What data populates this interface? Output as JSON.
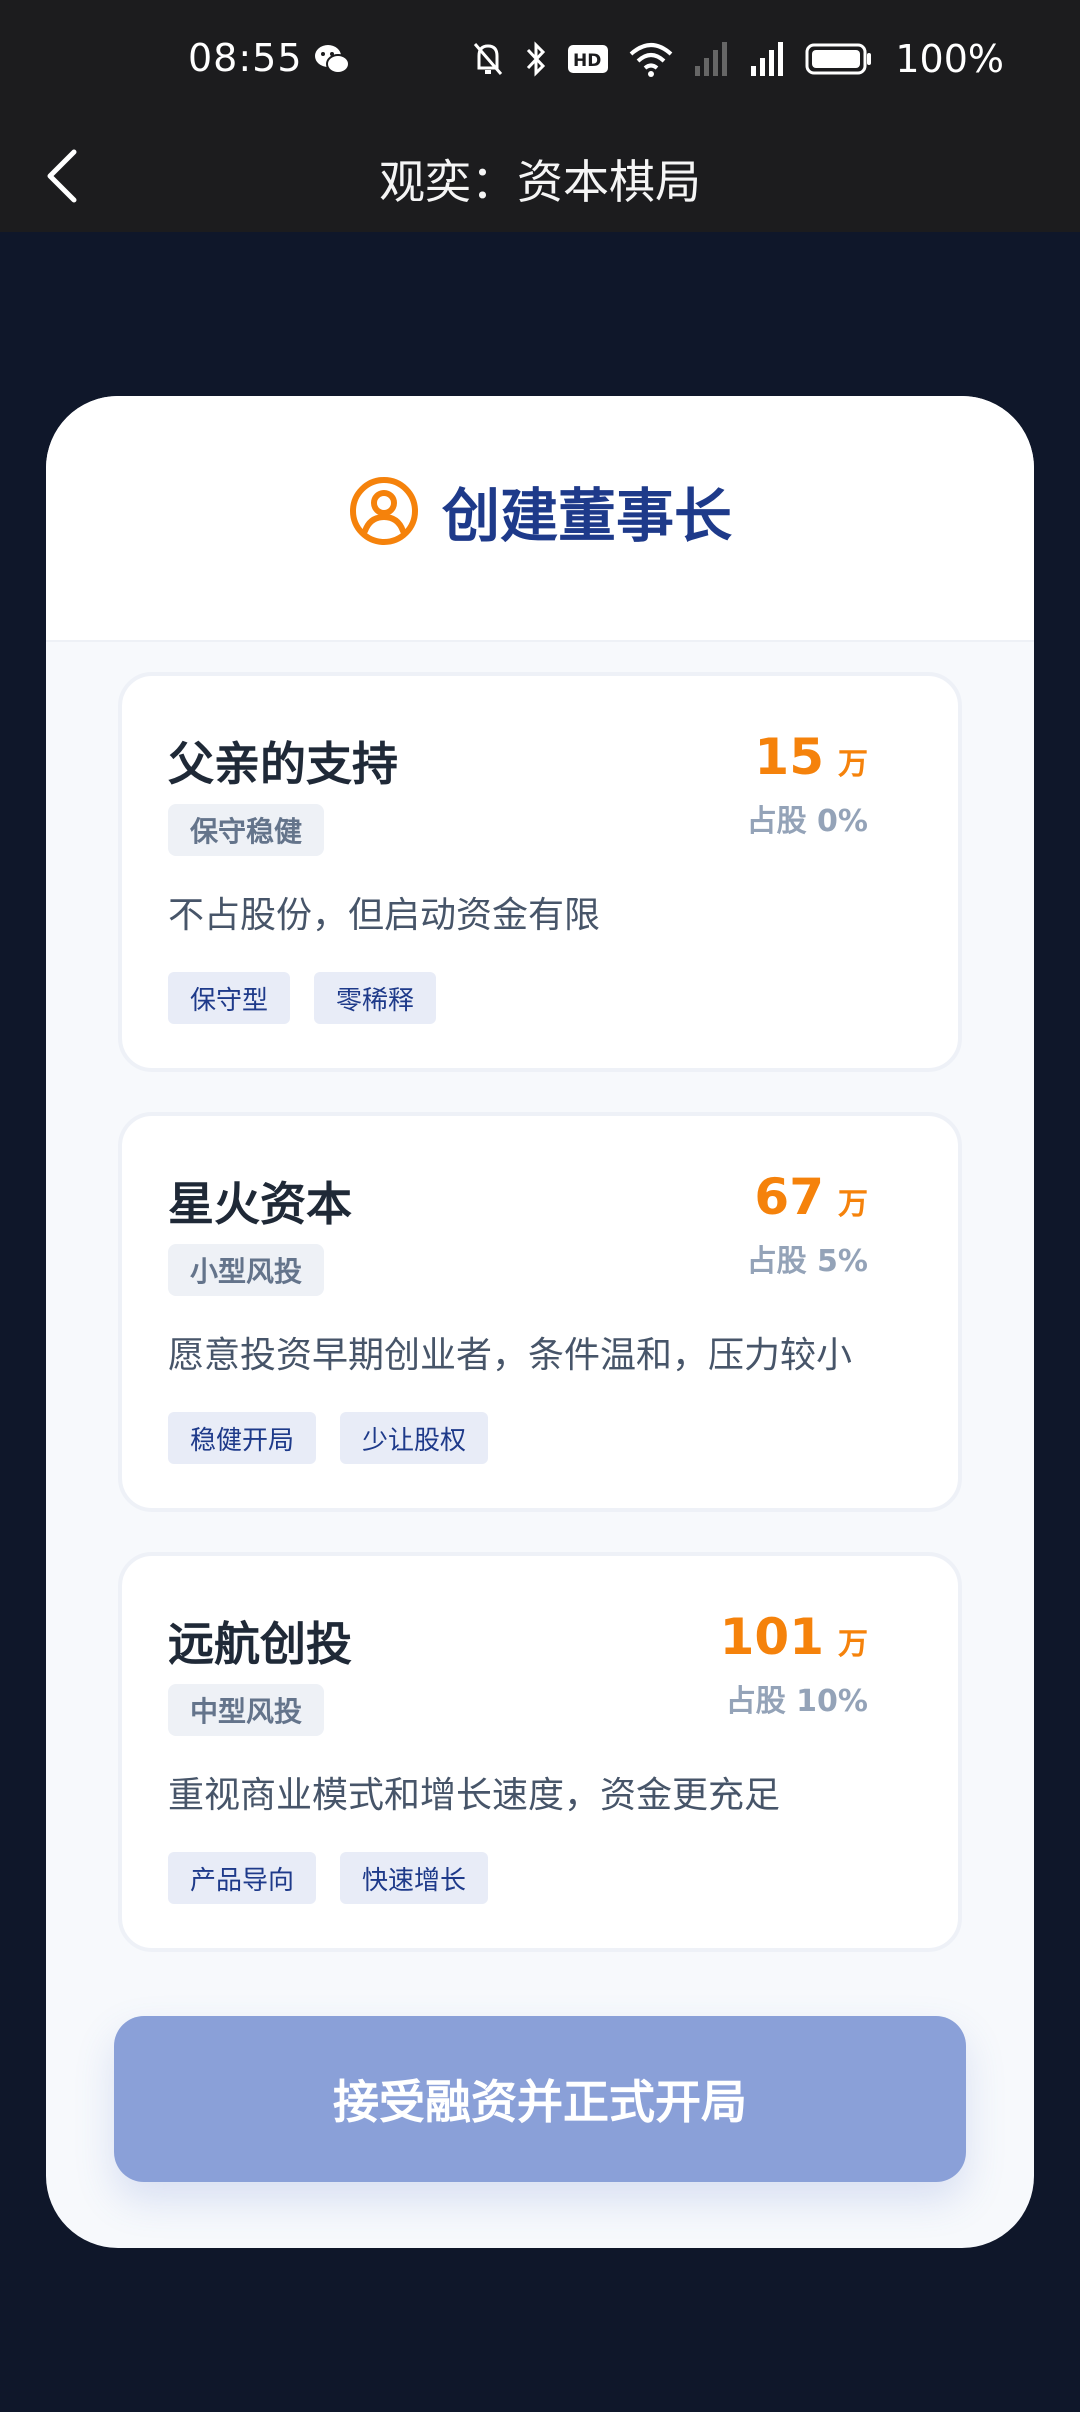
{
  "status_bar": {
    "time": "08:55",
    "battery": "100%",
    "icons": [
      "wechat-icon",
      "mute-icon",
      "bluetooth-icon",
      "hd-icon",
      "wifi-icon",
      "signal-icon",
      "battery-icon"
    ]
  },
  "nav": {
    "title": "观奕：资本棋局"
  },
  "modal": {
    "title": "创建董事长",
    "accent_color": "#f5820b",
    "title_color": "#1e3a8a"
  },
  "options": [
    {
      "name": "父亲的支持",
      "category": "保守稳健",
      "amount": "15",
      "unit": "万",
      "equity": "占股 0%",
      "description": "不占股份，但启动资金有限",
      "tags": [
        "保守型",
        "零稀释"
      ]
    },
    {
      "name": "星火资本",
      "category": "小型风投",
      "amount": "67",
      "unit": "万",
      "equity": "占股 5%",
      "description": "愿意投资早期创业者，条件温和，压力较小",
      "tags": [
        "稳健开局",
        "少让股权"
      ]
    },
    {
      "name": "远航创投",
      "category": "中型风投",
      "amount": "101",
      "unit": "万",
      "equity": "占股 10%",
      "description": "重视商业模式和增长速度，资金更充足",
      "tags": [
        "产品导向",
        "快速增长"
      ]
    }
  ],
  "action": {
    "label": "接受融资并正式开局"
  }
}
